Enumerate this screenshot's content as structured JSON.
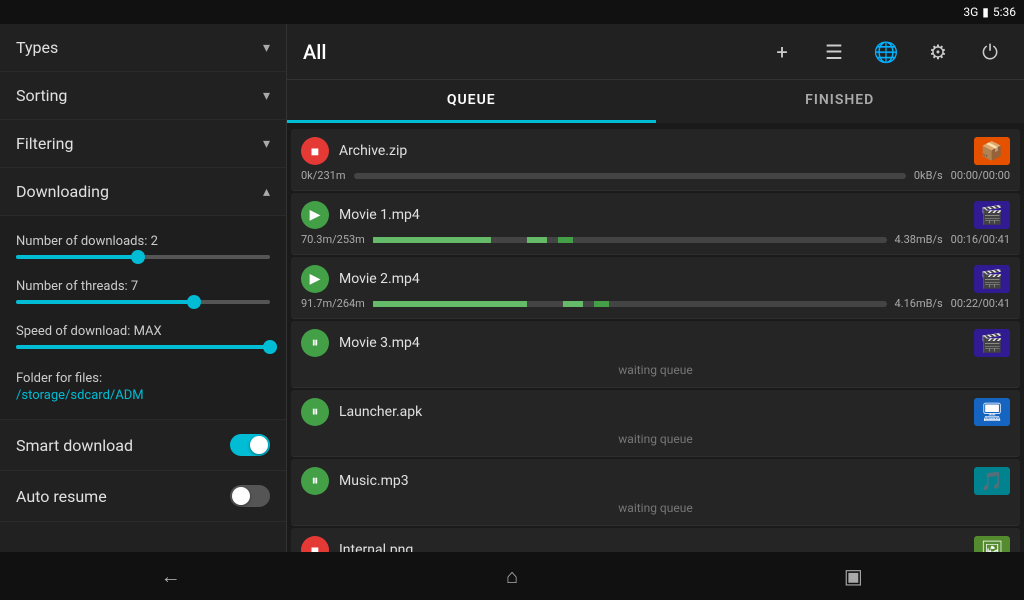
{
  "statusBar": {
    "signal": "3G",
    "time": "5:36",
    "batteryIcon": "🔋"
  },
  "sidebar": {
    "items": [
      {
        "id": "types",
        "label": "Types",
        "expandable": true
      },
      {
        "id": "sorting",
        "label": "Sorting",
        "expandable": true
      },
      {
        "id": "filtering",
        "label": "Filtering",
        "expandable": true
      },
      {
        "id": "downloading",
        "label": "Downloading",
        "expandable": true,
        "expanded": true
      }
    ],
    "downloading": {
      "downloads_label": "Number of downloads: 2",
      "downloads_value": 2,
      "downloads_percent": 48,
      "threads_label": "Number of threads: 7",
      "threads_value": 7,
      "threads_percent": 70,
      "speed_label": "Speed of download: MAX",
      "speed_percent": 100,
      "folder_label": "Folder for files:",
      "folder_path": "/storage/sdcard/ADM"
    },
    "smartDownload": {
      "label": "Smart download",
      "enabled": true
    },
    "autoResume": {
      "label": "Auto resume",
      "enabled": false
    }
  },
  "header": {
    "title": "All",
    "add_label": "+",
    "list_icon": "≡",
    "globe_icon": "🌐",
    "settings_icon": "⚙",
    "power_icon": "⏻"
  },
  "tabs": [
    {
      "id": "queue",
      "label": "QUEUE",
      "active": true
    },
    {
      "id": "finished",
      "label": "FINISHED",
      "active": false
    }
  ],
  "downloads": [
    {
      "id": "archive",
      "name": "Archive.zip",
      "status": "stop",
      "progress_text": "0k/231m",
      "speed": "0kB/s",
      "time": "00:00/00:00",
      "progress_percent": 0,
      "thumb_type": "zip",
      "thumb_icon": "📦",
      "waiting": false
    },
    {
      "id": "movie1",
      "name": "Movie 1.mp4",
      "status": "play",
      "progress_text": "70.3m/253m",
      "speed": "4.38mB/s",
      "time": "00:16/00:41",
      "progress_percent": 28,
      "thumb_type": "video",
      "thumb_icon": "🎬",
      "waiting": false
    },
    {
      "id": "movie2",
      "name": "Movie 2.mp4",
      "status": "play",
      "progress_text": "91.7m/264m",
      "speed": "4.16mB/s",
      "time": "00:22/00:41",
      "progress_percent": 35,
      "thumb_type": "video",
      "thumb_icon": "🎬",
      "waiting": false
    },
    {
      "id": "movie3",
      "name": "Movie 3.mp4",
      "status": "pause",
      "waiting": true,
      "waiting_text": "waiting queue",
      "thumb_type": "video",
      "thumb_icon": "🎬"
    },
    {
      "id": "launcher",
      "name": "Launcher.apk",
      "status": "pause",
      "waiting": true,
      "waiting_text": "waiting queue",
      "thumb_type": "app",
      "thumb_icon": "🖥"
    },
    {
      "id": "music",
      "name": "Music.mp3",
      "status": "pause",
      "waiting": true,
      "waiting_text": "waiting queue",
      "thumb_type": "music",
      "thumb_icon": "🎵"
    },
    {
      "id": "internal",
      "name": "Internal.png",
      "status": "stop",
      "waiting": true,
      "waiting_text": "",
      "thumb_type": "image",
      "thumb_icon": "🖼"
    }
  ],
  "bottomNav": {
    "back": "←",
    "home": "⌂",
    "recent": "▣"
  }
}
